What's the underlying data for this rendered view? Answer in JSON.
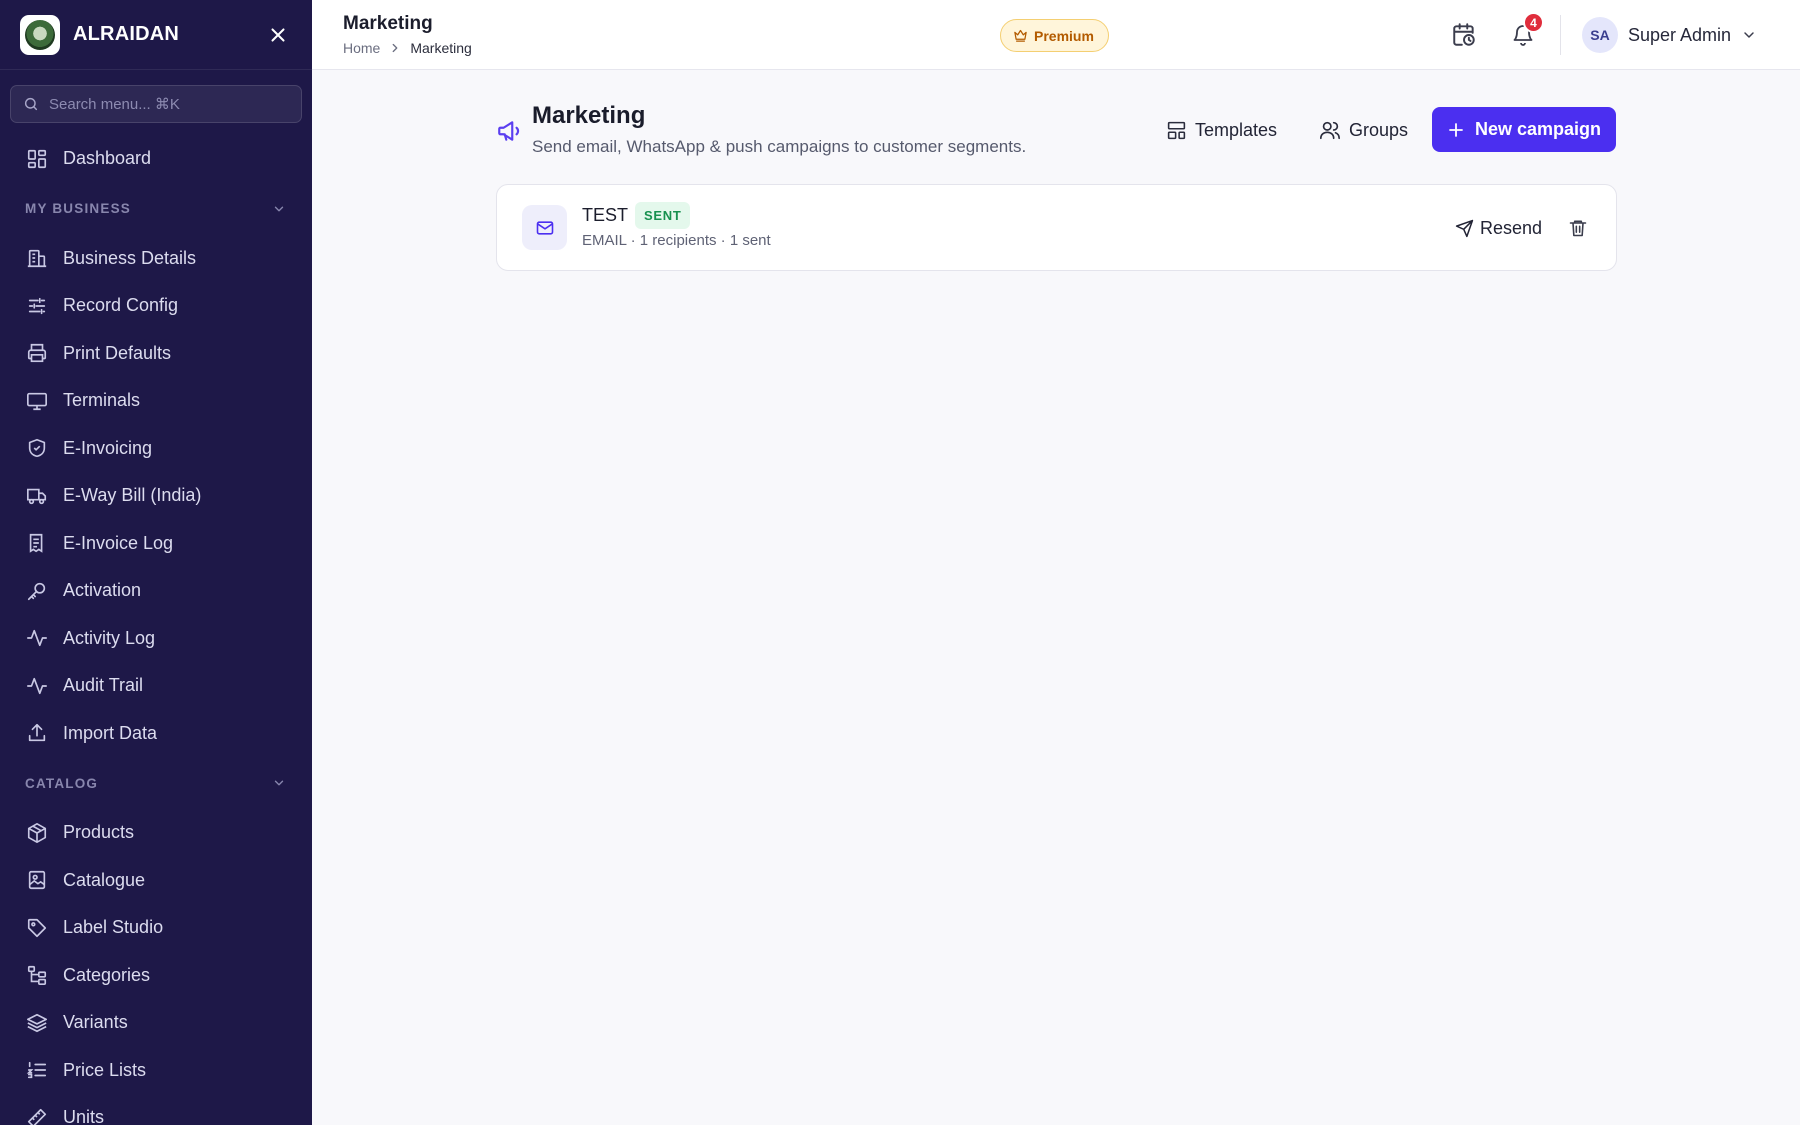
{
  "app": {
    "brand": "ALRAIDAN"
  },
  "sidebar": {
    "search_placeholder": "Search menu... ⌘K",
    "top_items": [
      {
        "label": "Dashboard",
        "icon": "dashboard-icon"
      }
    ],
    "sections": [
      {
        "title": "MY BUSINESS",
        "items": [
          {
            "label": "Business Details",
            "icon": "building-icon"
          },
          {
            "label": "Record Config",
            "icon": "sliders-icon"
          },
          {
            "label": "Print Defaults",
            "icon": "printer-icon"
          },
          {
            "label": "Terminals",
            "icon": "monitor-icon"
          },
          {
            "label": "E-Invoicing",
            "icon": "shield-check-icon"
          },
          {
            "label": "E-Way Bill (India)",
            "icon": "truck-icon"
          },
          {
            "label": "E-Invoice Log",
            "icon": "receipt-icon"
          },
          {
            "label": "Activation",
            "icon": "key-icon"
          },
          {
            "label": "Activity Log",
            "icon": "activity-icon"
          },
          {
            "label": "Audit Trail",
            "icon": "activity-icon"
          },
          {
            "label": "Import Data",
            "icon": "upload-icon"
          }
        ]
      },
      {
        "title": "CATALOG",
        "items": [
          {
            "label": "Products",
            "icon": "package-icon"
          },
          {
            "label": "Catalogue",
            "icon": "image-book-icon"
          },
          {
            "label": "Label Studio",
            "icon": "tag-icon"
          },
          {
            "label": "Categories",
            "icon": "tree-icon"
          },
          {
            "label": "Variants",
            "icon": "layers-icon"
          },
          {
            "label": "Price Lists",
            "icon": "list-ordered-icon"
          },
          {
            "label": "Units",
            "icon": "ruler-icon"
          }
        ]
      }
    ]
  },
  "topbar": {
    "title": "Marketing",
    "breadcrumb": {
      "home": "Home",
      "current": "Marketing"
    },
    "premium_label": "Premium",
    "notification_count": "4",
    "user": {
      "initials": "SA",
      "name": "Super Admin"
    }
  },
  "page": {
    "title": "Marketing",
    "subtitle": "Send email, WhatsApp & push campaigns to customer segments.",
    "templates_label": "Templates",
    "groups_label": "Groups",
    "new_campaign_label": "New campaign"
  },
  "campaigns": [
    {
      "name": "TEST",
      "status": "SENT",
      "meta": "EMAIL · 1 recipients · 1 sent",
      "resend_label": "Resend"
    }
  ],
  "colors": {
    "sidebar_bg": "#1e1848",
    "accent": "#4b2ff0",
    "status_sent": "#17914f",
    "premium": "#b35b00",
    "badge": "#e02d3c"
  }
}
